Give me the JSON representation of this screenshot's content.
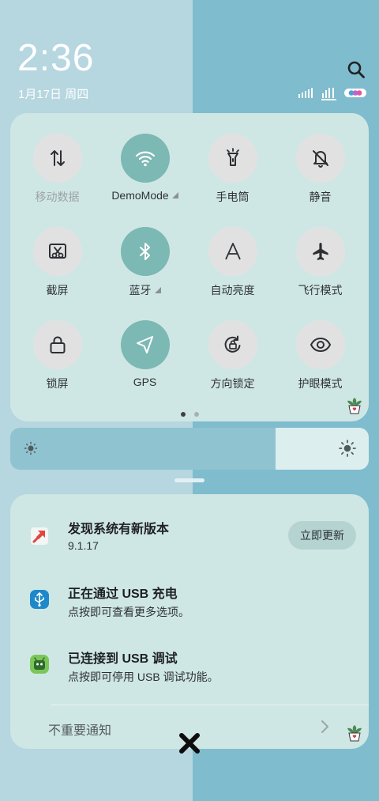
{
  "status_bar": {
    "time": "2:36",
    "date": "1月17日 周四"
  },
  "quick_settings": {
    "tiles": [
      {
        "label": "移动数据",
        "icon": "mobile-data-icon",
        "active": false,
        "dim": true
      },
      {
        "label": "DemoMode",
        "icon": "wifi-icon",
        "active": true,
        "expandable": true
      },
      {
        "label": "手电筒",
        "icon": "flashlight-icon",
        "active": false
      },
      {
        "label": "静音",
        "icon": "bell-off-icon",
        "active": false
      },
      {
        "label": "截屏",
        "icon": "screenshot-icon",
        "active": false
      },
      {
        "label": "蓝牙",
        "icon": "bluetooth-icon",
        "active": true,
        "expandable": true
      },
      {
        "label": "自动亮度",
        "icon": "auto-brightness-icon",
        "active": false
      },
      {
        "label": "飞行模式",
        "icon": "airplane-icon",
        "active": false
      },
      {
        "label": "锁屏",
        "icon": "lock-icon",
        "active": false
      },
      {
        "label": "GPS",
        "icon": "gps-icon",
        "active": true
      },
      {
        "label": "方向锁定",
        "icon": "rotation-lock-icon",
        "active": false
      },
      {
        "label": "护眼模式",
        "icon": "eye-icon",
        "active": false
      }
    ],
    "page_count": 2,
    "current_page": 1
  },
  "brightness": {
    "level": 0.74
  },
  "notifications": [
    {
      "title": "发现系统有新版本",
      "subtitle": "9.1.17",
      "icon": "system-update-icon",
      "action": "立即更新"
    },
    {
      "title": "正在通过 USB 充电",
      "subtitle": "点按即可查看更多选项。",
      "icon": "usb-icon"
    },
    {
      "title": "已连接到 USB 调试",
      "subtitle": "点按即可停用 USB 调试功能。",
      "icon": "android-debug-icon"
    }
  ],
  "footer": {
    "unimportant_label": "不重要通知"
  },
  "colors": {
    "panel": "#cfe7e4",
    "tile_active": "#7cb8b4",
    "tile_inactive": "#e2e1e2",
    "brightness_fill": "#8fc3cf"
  }
}
